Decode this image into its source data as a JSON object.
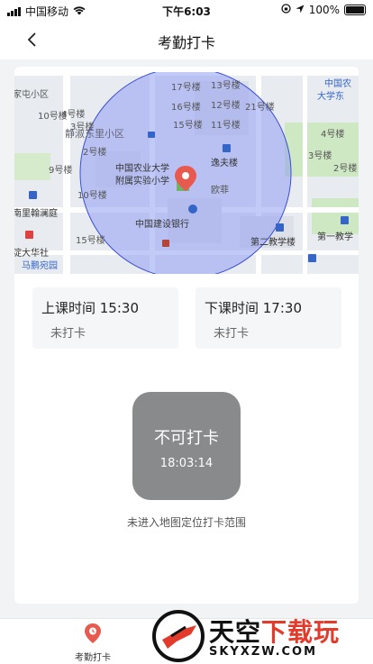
{
  "status_bar": {
    "carrier": "中国移动",
    "time": "下午6:03",
    "battery": "100%"
  },
  "nav": {
    "title": "考勤打卡"
  },
  "map": {
    "labels": {
      "district_top_left": "家屯小区",
      "jingchun": "静淑东里小区",
      "b17": "17号楼",
      "b13": "13号楼",
      "b16": "16号楼",
      "b12": "12号楼",
      "b15": "15号楼",
      "b11": "11号楼",
      "b21": "21号楼",
      "b10a": "10号楼",
      "b4": "4号楼",
      "b3": "3号楼",
      "b2": "2号楼",
      "b9": "9号楼",
      "b10b": "10号楼",
      "b15b": "15号楼",
      "school": "中国农业大学",
      "school2": "附属实验小学",
      "yifu": "逸夫楼",
      "bank": "中国建设银行",
      "cau_right": "中国农",
      "cau_right2": "大学东",
      "b4r": "4号楼",
      "b3r": "3号楼",
      "b2r": "2号楼",
      "teach1": "第一教学",
      "teach2": "第二教学楼",
      "hanlin": "南里翰澜庭",
      "huashe": "淀大华社",
      "ouhe": "欧菲",
      "shouyu": "马鹏宛园"
    },
    "colors": {
      "circle_fill": "#8f9ff2",
      "circle_stroke": "#3a4fd6",
      "pin": "#e85a4f"
    }
  },
  "class_start": {
    "label": "上课时间 15:30",
    "status": "未打卡"
  },
  "class_end": {
    "label": "下课时间 17:30",
    "status": "未打卡"
  },
  "punch": {
    "button_text": "不可打卡",
    "time": "18:03:14",
    "hint": "未进入地图定位打卡范围"
  },
  "tabs": [
    {
      "label": "考勤打卡",
      "icon": "location-pin-icon",
      "active_color": "#e85a4f"
    }
  ],
  "watermark": {
    "title_black": "天空",
    "title_red": "下载玩",
    "subtitle": "SKYXZW.COM"
  }
}
